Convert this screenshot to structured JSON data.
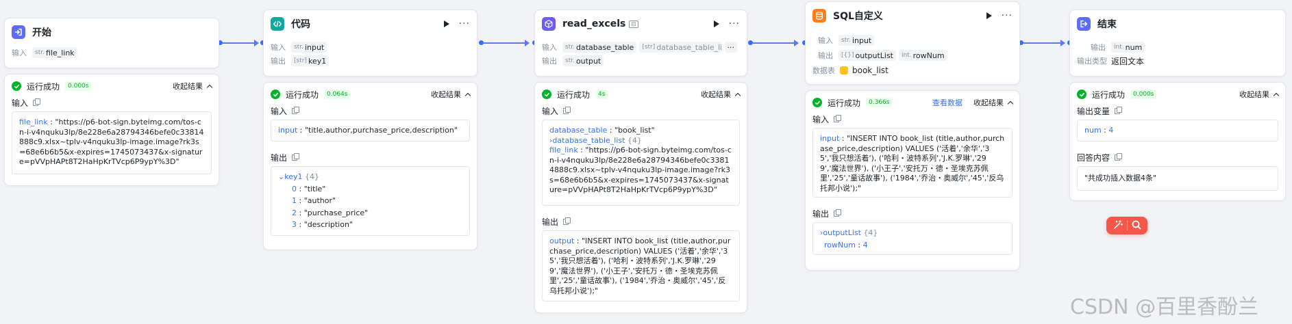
{
  "common": {
    "input_label": "输入",
    "output_label": "输出",
    "run_success": "运行成功",
    "collapse": "收起结果",
    "more": "···"
  },
  "colors": {
    "accent": "#3370ff",
    "success": "#00b42a",
    "start_icon": "#5b6cf9",
    "code_icon": "#13a89e",
    "read_excels_icon": "#6b5cf4",
    "sql_icon": "#ff7d1a",
    "end_icon": "#5b6cf9"
  },
  "nodes": {
    "start": {
      "title": "开始",
      "icon": "arrow-enter-icon",
      "input_field": {
        "type": "str.",
        "name": "file_link"
      },
      "result": {
        "time": "0.000s",
        "input_label": "输入",
        "input": {
          "key": "file_link",
          "value": "\"https://p6-bot-sign.byteimg.com/tos-cn-i-v4nquku3lp/8e228e6a28794346befe0c33814888c9.xlsx~tplv-v4nquku3lp-image.image?rk3s=68e6b6b5&x-expires=1745073437&x-signature=pVVpHAPt8T2HaHpKrTVcp6P9ypY%3D\""
        }
      }
    },
    "code": {
      "title": "代码",
      "icon": "code-icon",
      "input_field": {
        "type": "str.",
        "name": "input"
      },
      "output_field": {
        "type": "[str]",
        "name": "key1"
      },
      "result": {
        "time": "0.064s",
        "input": {
          "key": "input",
          "value": "\"title,author,purchase_price,description\""
        },
        "output": {
          "key": "key1",
          "count": "{4}",
          "items": [
            {
              "index": "0",
              "value": "\"title\""
            },
            {
              "index": "1",
              "value": "\"author\""
            },
            {
              "index": "2",
              "value": "\"purchase_price\""
            },
            {
              "index": "3",
              "value": "\"description\""
            }
          ]
        }
      }
    },
    "read_excels": {
      "title": "read_excels",
      "icon": "cube-icon",
      "input_fields": [
        {
          "type": "str.",
          "name": "database_table"
        },
        {
          "type": "[str]",
          "name": "database_table_list"
        }
      ],
      "output_field": {
        "type": "str.",
        "name": "output"
      },
      "result": {
        "time": "4s",
        "input": {
          "database_table_key": "database_table",
          "database_table_value": "\"book_list\"",
          "database_table_list_key": "database_table_list",
          "database_table_list_count": "{4}",
          "file_link_key": "file_link",
          "file_link_value": "\"https://p6-bot-sign.byteimg.com/tos-cn-i-v4nquku3lp/8e228e6a28794346befe0c33814888c9.xlsx~tplv-v4nquku3lp-image.image?rk3s=68e6b6b5&x-expires=1745073437&x-signature=pVVpHAPt8T2HaHpKrTVcp6P9ypY%3D\""
        },
        "output": {
          "key": "output",
          "value": "\"INSERT INTO book_list (title,author,purchase_price,description) VALUES ('活着','余华','35','我只想活着'), ('哈利・波特系列','J.K.罗琳','299','魔法世界'), ('小王子','安托万・德・圣埃克苏佩里','25','童话故事'), ('1984','乔治・奥威尔','45','反乌托邦小说');\""
        }
      }
    },
    "sql": {
      "title": "SQL自定义",
      "icon": "database-icon",
      "input_field": {
        "type": "str.",
        "name": "input"
      },
      "output_fields": [
        {
          "type": "[{}]",
          "name": "outputList"
        },
        {
          "type": "int.",
          "name": "rowNum"
        }
      ],
      "table_label": "数据表",
      "table_name": "book_list",
      "result": {
        "time": "0.366s",
        "view_data": "查看数据",
        "input": {
          "key": "input",
          "value": "\"INSERT INTO book_list (title,author,purchase_price,description) VALUES ('活着','余华','35','我只想活着'), ('哈利・波特系列','J.K.罗琳','299','魔法世界'), ('小王子','安托万・德・圣埃克苏佩里','25','童话故事'), ('1984','乔治・奥威尔','45','反乌托邦小说');\""
        },
        "output": {
          "list_key": "outputList",
          "list_count": "{4}",
          "rownum_key": "rowNum",
          "rownum_value": "4"
        }
      }
    },
    "end": {
      "title": "结束",
      "icon": "exit-icon",
      "output_var_label": "输出",
      "output_field": {
        "type": "int.",
        "name": "num"
      },
      "output_type_label": "输出类型",
      "output_type_value": "返回文本",
      "result": {
        "time": "0.000s",
        "output_var_title": "输出变量",
        "num_key": "num",
        "num_value": "4",
        "answer_title": "回答内容",
        "answer_value": "\"共成功插入数据4条\""
      }
    }
  },
  "watermark": "CSDN @百里香酚兰"
}
